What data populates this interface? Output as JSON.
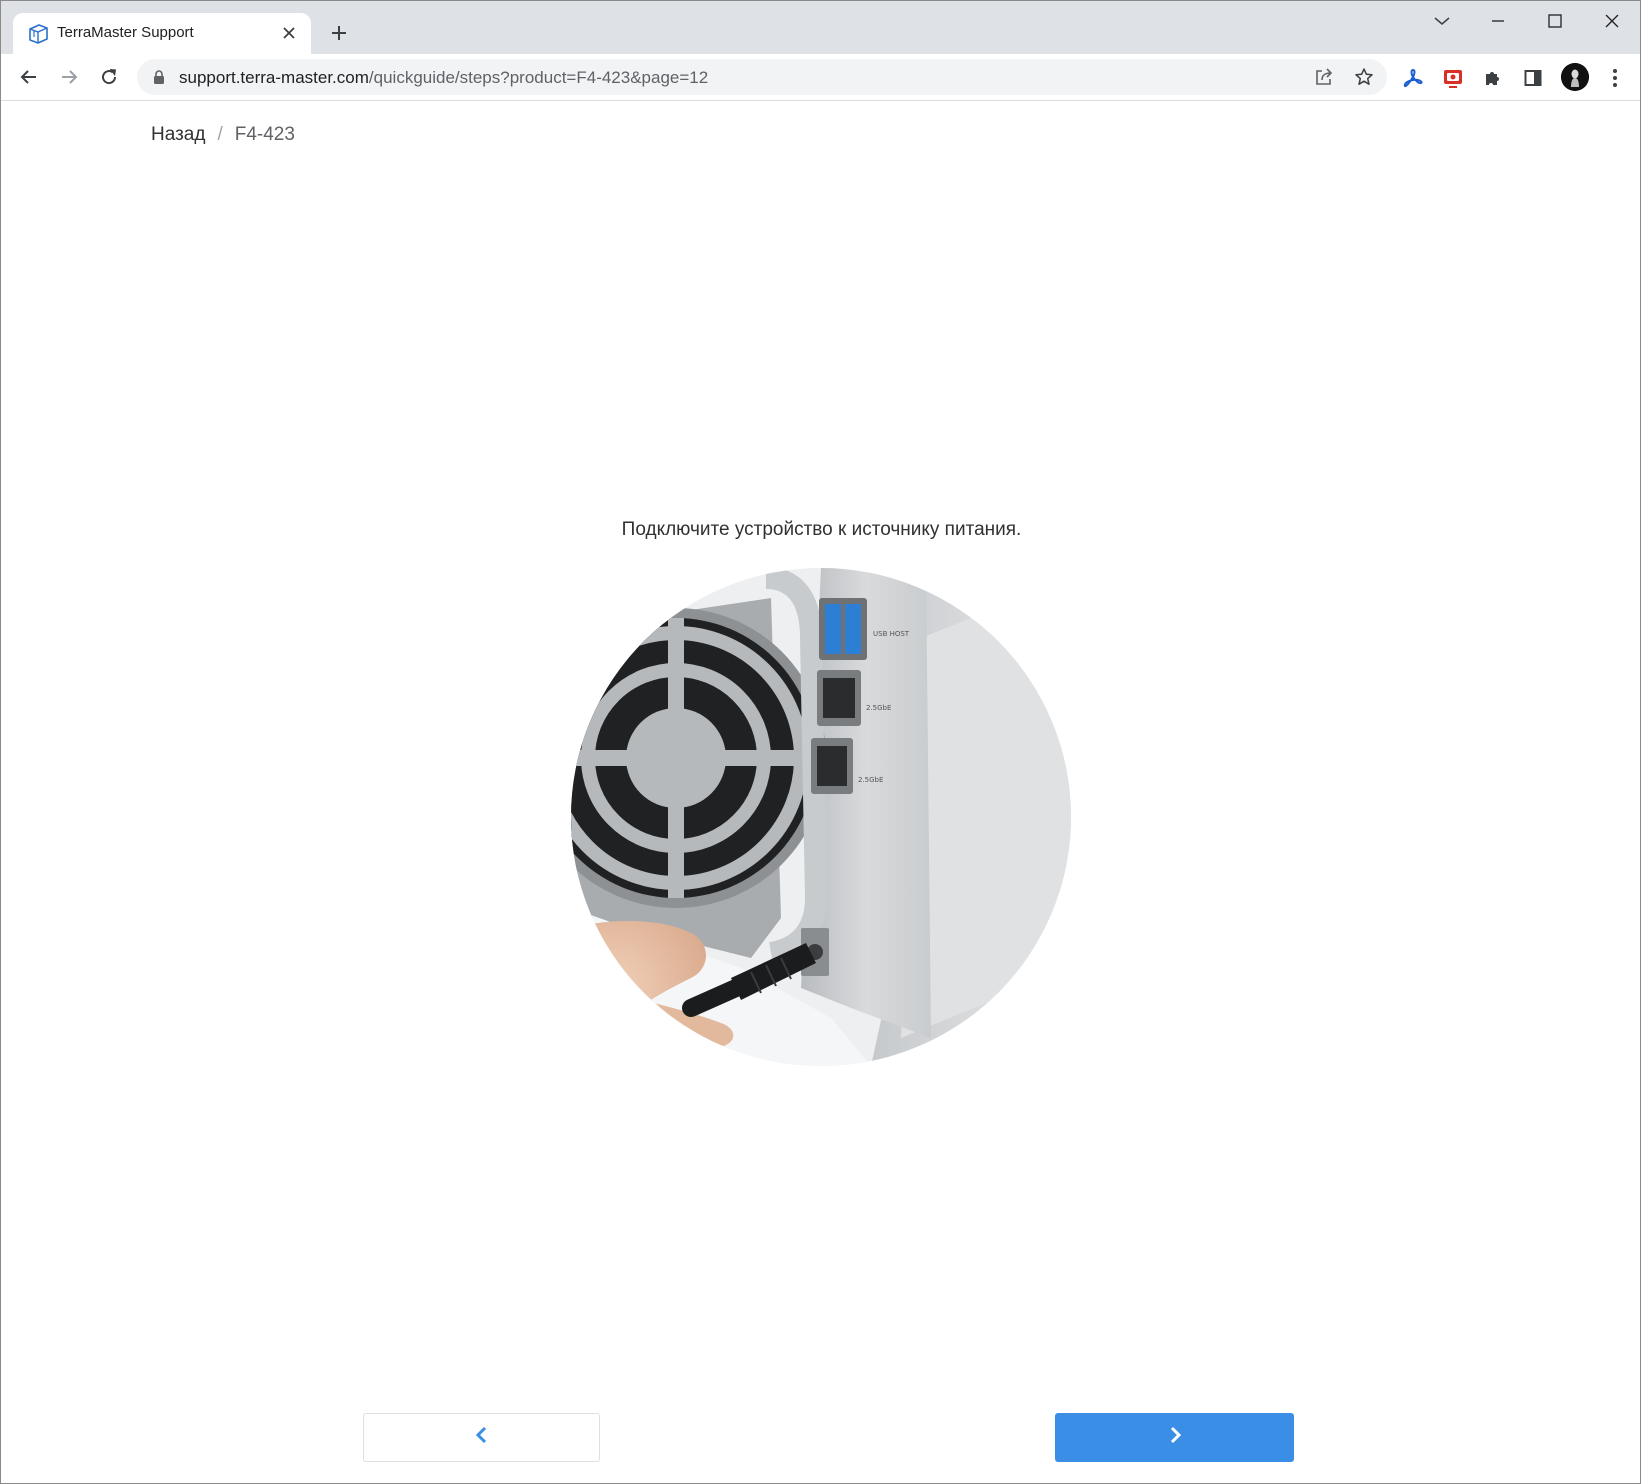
{
  "browser": {
    "tab": {
      "title": "TerraMaster Support",
      "favicon": "terramaster-logo-icon"
    },
    "omnibox": {
      "url_host": "support.terra-master.com",
      "url_path": "/quickguide/steps?product=F4-423&page=12"
    },
    "icons": {
      "back": "back-arrow-icon",
      "forward": "forward-arrow-icon",
      "reload": "reload-icon",
      "share": "share-icon",
      "bookmark": "star-icon",
      "extensions": "puzzle-icon",
      "side_panel": "side-panel-icon",
      "menu": "kebab-menu-icon"
    },
    "colors": {
      "tabstrip": "#dee1e6",
      "omnibox": "#f1f3f4"
    }
  },
  "page": {
    "breadcrumb": {
      "back_label": "Назад",
      "separator": "/",
      "current": "F4-423"
    },
    "step_text": "Подключите устройство к источнику питания.",
    "photo": {
      "port_labels": [
        "USB HOST",
        "2.5GbE",
        "2.5GbE"
      ]
    },
    "navigation": {
      "prev_icon": "chevron-left-icon",
      "next_icon": "chevron-right-icon"
    },
    "colors": {
      "primary": "#3a8ee6",
      "text": "#303133",
      "muted": "#606266"
    }
  }
}
